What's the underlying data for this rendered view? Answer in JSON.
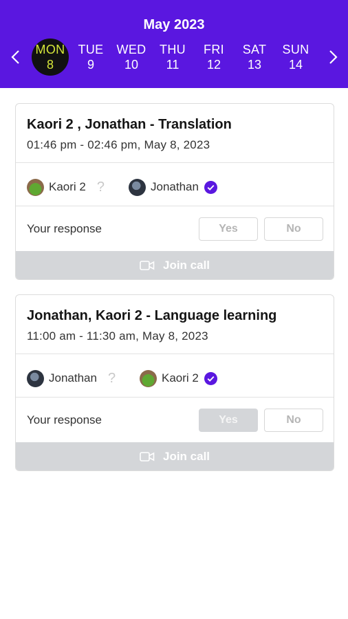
{
  "calendar": {
    "month_label": "May 2023",
    "days": [
      {
        "name": "MON",
        "date": "8",
        "selected": true
      },
      {
        "name": "TUE",
        "date": "9"
      },
      {
        "name": "WED",
        "date": "10"
      },
      {
        "name": "THU",
        "date": "11"
      },
      {
        "name": "FRI",
        "date": "12"
      },
      {
        "name": "SAT",
        "date": "13"
      },
      {
        "name": "SUN",
        "date": "14"
      }
    ]
  },
  "meetings": [
    {
      "title": "Kaori 2 , Jonathan - Translation",
      "time": "01:46 pm - 02:46 pm, May 8, 2023",
      "participants": [
        {
          "name": "Kaori 2",
          "status": "?"
        },
        {
          "name": "Jonathan",
          "status": "accepted"
        }
      ],
      "response_label": "Your response",
      "yes_label": "Yes",
      "no_label": "No",
      "selected_response": "none",
      "join_label": "Join call"
    },
    {
      "title": "Jonathan, Kaori 2  - Language learning",
      "time": "11:00 am - 11:30 am, May 8, 2023",
      "participants": [
        {
          "name": "Jonathan",
          "status": "?"
        },
        {
          "name": "Kaori 2",
          "status": "accepted"
        }
      ],
      "response_label": "Your response",
      "yes_label": "Yes",
      "no_label": "No",
      "selected_response": "yes",
      "join_label": "Join call"
    }
  ],
  "colors": {
    "header_bg": "#5a17e0",
    "selected_day_bg": "#111111",
    "selected_day_text": "#d6e83a",
    "check_color": "#5a17e0",
    "join_bg": "#d4d6d9"
  },
  "icons": {
    "prev": "chevron-left-icon",
    "next": "chevron-right-icon",
    "accepted": "check-circle-icon",
    "pending": "question-mark-icon",
    "join": "video-camera-icon"
  }
}
